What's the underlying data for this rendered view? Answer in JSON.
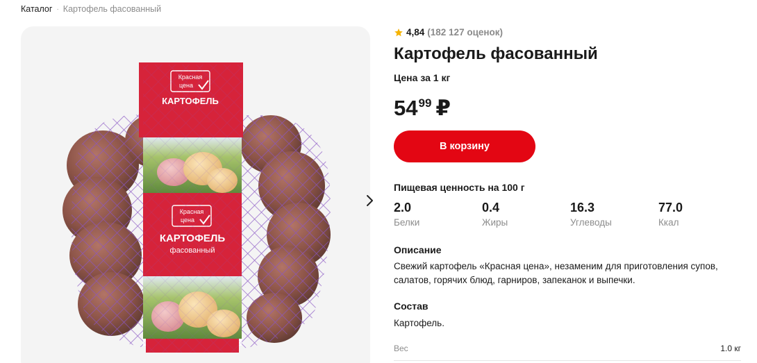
{
  "breadcrumb": {
    "catalog": "Каталог",
    "separator": "·",
    "current": "Картофель фасованный"
  },
  "product": {
    "rating": "4,84",
    "rating_count": "(182 127 оценок)",
    "title": "Картофель фасованный",
    "unit_label": "Цена за 1 кг",
    "price_int": "54",
    "price_frac": "99",
    "currency": "₽",
    "cart_label": "В корзину"
  },
  "package": {
    "brand_line1": "Красная",
    "brand_line2": "цена",
    "name": "КАРТОФЕЛЬ",
    "subtitle": "фасованный"
  },
  "nutrition": {
    "title": "Пищевая ценность на 100 г",
    "items": [
      {
        "value": "2.0",
        "label": "Белки"
      },
      {
        "value": "0.4",
        "label": "Жиры"
      },
      {
        "value": "16.3",
        "label": "Углеводы"
      },
      {
        "value": "77.0",
        "label": "Ккал"
      }
    ]
  },
  "description": {
    "title": "Описание",
    "text": "Свежий картофель «Красная цена», незаменим для приготовления супов, салатов, горячих блюд, гарниров, запеканок и выпечки."
  },
  "composition": {
    "title": "Состав",
    "text": "Картофель."
  },
  "specs": [
    {
      "label": "Вес",
      "value": "1.0 кг"
    }
  ],
  "colors": {
    "accent": "#e30613",
    "star": "#f5b301",
    "label_red": "#d6233a",
    "net_purple": "#8a56c4"
  },
  "icons": {
    "rating": "star-icon",
    "next": "chevron-right-icon",
    "brand": "checkmark-icon"
  }
}
